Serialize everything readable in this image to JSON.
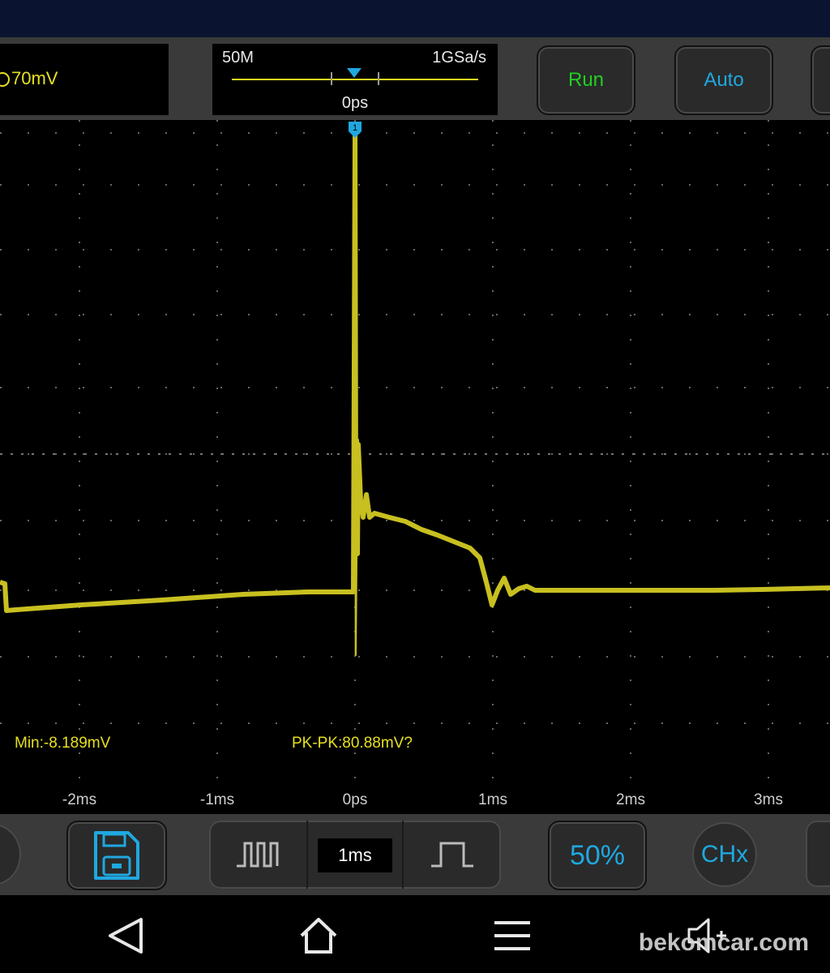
{
  "trigger": {
    "level": "70mV"
  },
  "timebase": {
    "memory_depth": "50M",
    "sample_rate": "1GSa/s",
    "offset": "0ps"
  },
  "toolbar": {
    "run_label": "Run",
    "auto_label": "Auto"
  },
  "measurements": {
    "min": "Min:-8.189mV",
    "pk_pk": "PK-PK:80.88mV?"
  },
  "axis": {
    "ticks": [
      "-2ms",
      "-1ms",
      "0ps",
      "1ms",
      "2ms",
      "3ms"
    ]
  },
  "bottom_controls": {
    "time_div": "1ms",
    "percent_label": "50%",
    "channel_label": "CHx"
  },
  "channel_marker": {
    "label": "1"
  },
  "watermark": "bekomcar.com",
  "colors": {
    "trace": "#c8c020",
    "accent": "#1fa8e0",
    "run": "#22d022",
    "panel": "#3a3a3a"
  },
  "icons": [
    "save-icon",
    "pulse-narrow-icon",
    "pulse-wide-icon",
    "back-icon",
    "home-icon",
    "menu-icon",
    "volume-up-icon"
  ]
}
